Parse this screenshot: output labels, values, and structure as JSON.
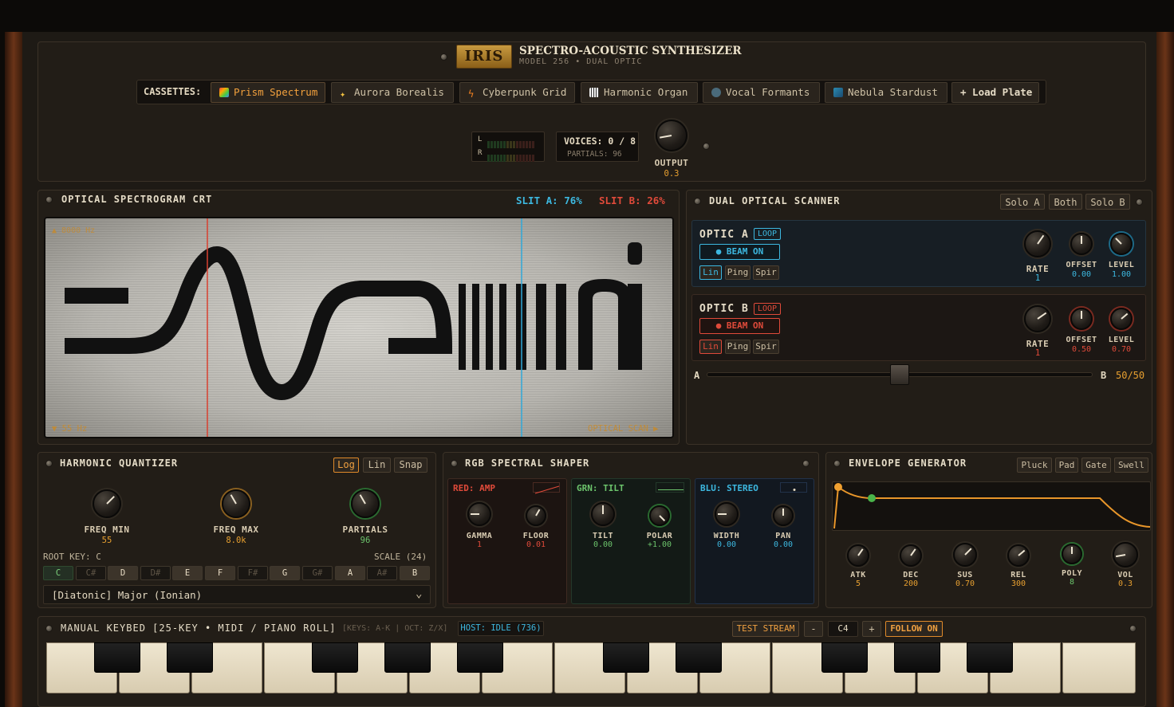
{
  "header": {
    "logo": "IRIS",
    "title": "SPECTRO-ACOUSTIC SYNTHESIZER",
    "subtitle": "MODEL 256 • DUAL OPTIC"
  },
  "cassettes": {
    "label": "CASSETTES:",
    "items": [
      {
        "label": "Prism Spectrum",
        "icon": "rainbow-icon"
      },
      {
        "label": "Aurora Borealis",
        "icon": "sparkle-icon"
      },
      {
        "label": "Cyberpunk Grid",
        "icon": "lightning-icon"
      },
      {
        "label": "Harmonic Organ",
        "icon": "organ-icon"
      },
      {
        "label": "Vocal Formants",
        "icon": "voice-icon"
      },
      {
        "label": "Nebula Stardust",
        "icon": "nebula-icon"
      }
    ],
    "load": "+ Load Plate",
    "selected": 0
  },
  "meters": {
    "l": "L",
    "r": "R",
    "voices": "VOICES: 0 / 8",
    "partials": "PARTIALS: 96",
    "output_label": "OUTPUT",
    "output_value": "0.3"
  },
  "crt": {
    "title": "OPTICAL SPECTROGRAM CRT",
    "slit_a": "SLIT A: 76%",
    "slit_b": "SLIT B: 26%",
    "top_freq": "▲ 8000 Hz",
    "bottom_freq": "▼ 55 Hz",
    "scan": "OPTICAL SCAN ▶"
  },
  "scanner": {
    "title": "DUAL OPTICAL SCANNER",
    "solo_a": "Solo A",
    "both": "Both",
    "solo_b": "Solo B",
    "optic_a": {
      "name": "OPTIC A",
      "loop": "LOOP",
      "beam": "● BEAM ON",
      "modes": [
        "Lin",
        "Ping",
        "Spir"
      ],
      "rate_label": "RATE",
      "rate": "1",
      "offset_label": "OFFSET",
      "offset": "0.00",
      "level_label": "LEVEL",
      "level": "1.00"
    },
    "optic_b": {
      "name": "OPTIC B",
      "loop": "LOOP",
      "beam": "● BEAM ON",
      "modes": [
        "Lin",
        "Ping",
        "Spir"
      ],
      "rate_label": "RATE",
      "rate": "1",
      "offset_label": "OFFSET",
      "offset": "0.50",
      "level_label": "LEVEL",
      "level": "0.70"
    },
    "xfade_a": "A",
    "xfade_b": "B",
    "xfade_value": "50/50"
  },
  "quantizer": {
    "title": "HARMONIC QUANTIZER",
    "modes": [
      "Log",
      "Lin",
      "Snap"
    ],
    "freq_min_label": "FREQ MIN",
    "freq_min": "55",
    "freq_max_label": "FREQ MAX",
    "freq_max": "8.0k",
    "partials_label": "PARTIALS",
    "partials": "96",
    "root_key": "ROOT KEY: C",
    "scale": "SCALE (24)",
    "notes": [
      "C",
      "C#",
      "D",
      "D#",
      "E",
      "F",
      "F#",
      "G",
      "G#",
      "A",
      "A#",
      "B"
    ],
    "scale_name": "[Diatonic] Major (Ionian)"
  },
  "shaper": {
    "title": "RGB SPECTRAL SHAPER",
    "red": {
      "name": "RED: AMP",
      "k1": "GAMMA",
      "v1": "1",
      "k2": "FLOOR",
      "v2": "0.01"
    },
    "grn": {
      "name": "GRN: TILT",
      "k1": "TILT",
      "v1": "0.00",
      "k2": "POLAR",
      "v2": "+1.00"
    },
    "blu": {
      "name": "BLU: STEREO",
      "k1": "WIDTH",
      "v1": "0.00",
      "k2": "PAN",
      "v2": "0.00"
    }
  },
  "envelope": {
    "title": "ENVELOPE GENERATOR",
    "presets": [
      "Pluck",
      "Pad",
      "Gate",
      "Swell"
    ],
    "knobs": [
      {
        "label": "ATK",
        "value": "5"
      },
      {
        "label": "DEC",
        "value": "200"
      },
      {
        "label": "SUS",
        "value": "0.70"
      },
      {
        "label": "REL",
        "value": "300"
      },
      {
        "label": "POLY",
        "value": "8"
      },
      {
        "label": "VOL",
        "value": "0.3"
      }
    ]
  },
  "keybed": {
    "title": "MANUAL KEYBED [25-KEY • MIDI / PIANO ROLL]",
    "hint": "[KEYS: A-K | OCT: Z/X]",
    "host": "HOST: IDLE (736)",
    "test": "TEST STREAM",
    "minus": "-",
    "octave": "C4",
    "plus": "+",
    "follow": "FOLLOW ON"
  }
}
